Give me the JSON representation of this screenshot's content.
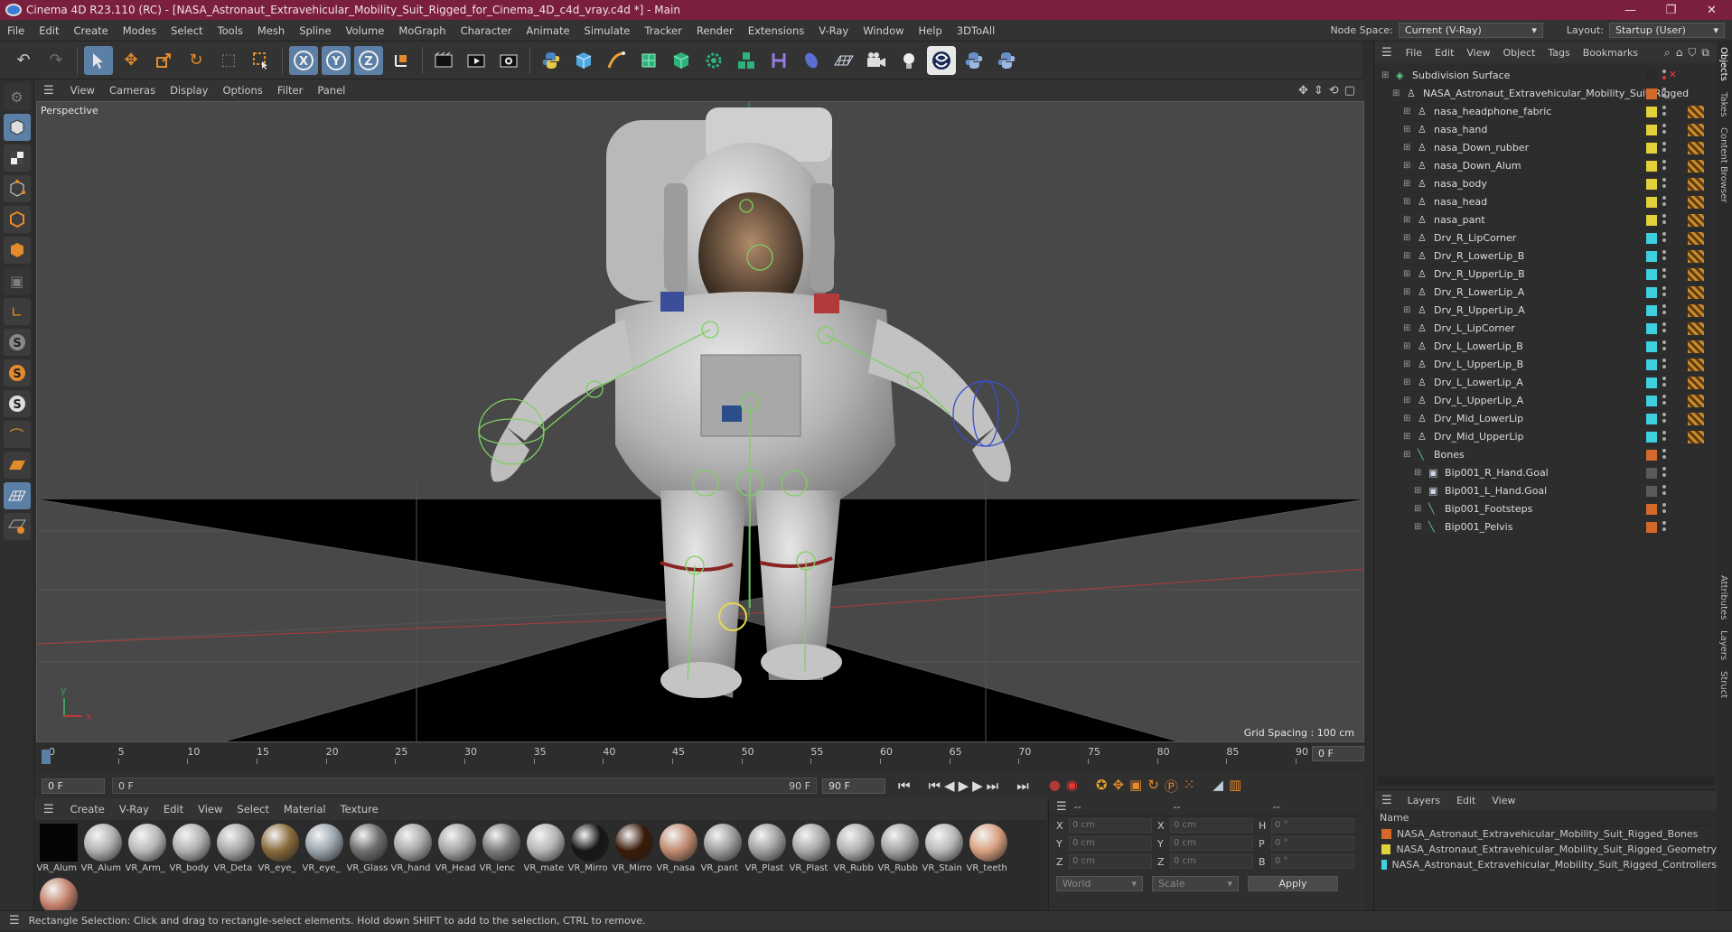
{
  "window": {
    "title": "Cinema 4D R23.110 (RC) - [NASA_Astronaut_Extravehicular_Mobility_Suit_Rigged_for_Cinema_4D_c4d_vray.c4d *] - Main",
    "controls": [
      "—",
      "❐",
      "✕"
    ]
  },
  "menu": [
    "File",
    "Edit",
    "Create",
    "Modes",
    "Select",
    "Tools",
    "Mesh",
    "Spline",
    "Volume",
    "MoGraph",
    "Character",
    "Animate",
    "Simulate",
    "Tracker",
    "Render",
    "Extensions",
    "V-Ray",
    "Window",
    "Help",
    "3DToAll"
  ],
  "node_space": {
    "label": "Node Space:",
    "value": "Current (V-Ray)"
  },
  "layout": {
    "label": "Layout:",
    "value": "Startup (User)"
  },
  "toolbar_icons": [
    "undo-icon",
    "redo-icon",
    "select-icon",
    "move-icon",
    "scale-icon",
    "rotate-icon",
    "recent-icon",
    "rect-select-icon",
    "x-axis-icon",
    "y-axis-icon",
    "z-axis-icon",
    "coord-system-icon",
    "render-view-icon",
    "render-picture-viewer-icon",
    "render-settings-icon",
    "python-icon",
    "cube-icon",
    "pen-icon",
    "subdivision-icon",
    "extrude-icon",
    "gear-generator-icon",
    "cloner-icon",
    "deformer-icon",
    "field-icon",
    "floor-icon",
    "camera-icon",
    "light-icon",
    "vray-icon",
    "python2-icon",
    "python3-icon"
  ],
  "viewport": {
    "menu": [
      "View",
      "Cameras",
      "Display",
      "Options",
      "Filter",
      "Panel"
    ],
    "name": "Perspective",
    "grid_spacing": "Grid Spacing : 100 cm",
    "axis_y": "y",
    "axis_x": "x"
  },
  "timeline": {
    "ticks": [
      "0",
      "5",
      "10",
      "15",
      "20",
      "25",
      "30",
      "35",
      "40",
      "45",
      "50",
      "55",
      "60",
      "65",
      "70",
      "75",
      "80",
      "85",
      "90"
    ],
    "current_frame": "0 F",
    "start_frame": "0 F",
    "slider_start": "0 F",
    "slider_end": "90 F",
    "end_frame": "90 F"
  },
  "material_menu": [
    "Create",
    "V-Ray",
    "Edit",
    "View",
    "Select",
    "Material",
    "Texture"
  ],
  "materials": [
    {
      "label": "VR_Alum",
      "color": "#050505"
    },
    {
      "label": "VR_Alum",
      "color": "#b0b0b0"
    },
    {
      "label": "VR_Arm_",
      "color": "#b8b8b8"
    },
    {
      "label": "VR_body",
      "color": "#b0b0b0"
    },
    {
      "label": "VR_Deta",
      "color": "#a8a8a8"
    },
    {
      "label": "VR_eye_",
      "color": "#8a6a3a"
    },
    {
      "label": "VR_eye_",
      "color": "#9aa4ad"
    },
    {
      "label": "VR_Glass",
      "color": "#6e6e6e"
    },
    {
      "label": "VR_hand",
      "color": "#a8a8a8"
    },
    {
      "label": "VR_Head",
      "color": "#a4a4a4"
    },
    {
      "label": "VR_lenc",
      "color": "#7a7a7a"
    },
    {
      "label": "VR_mate",
      "color": "#b4b4b4"
    },
    {
      "label": "VR_Mirro",
      "color": "#151515"
    },
    {
      "label": "VR_Mirro",
      "color": "#3a1a08"
    },
    {
      "label": "VR_nasa",
      "color": "#c08a70"
    },
    {
      "label": "VR_pant",
      "color": "#9c9c9c"
    },
    {
      "label": "VR_Plast",
      "color": "#a0a0a0"
    },
    {
      "label": "VR_Plast",
      "color": "#a8a8a8"
    },
    {
      "label": "VR_Rubb",
      "color": "#b0b0b0"
    },
    {
      "label": "VR_Rubb",
      "color": "#a4a4a4"
    },
    {
      "label": "VR_Stain",
      "color": "#b8b8b8"
    },
    {
      "label": "VR_teeth",
      "color": "#d9a080"
    },
    {
      "label": "",
      "color": "#c4806a"
    }
  ],
  "coords": {
    "header": [
      "--",
      "--",
      "--"
    ],
    "rows": [
      {
        "a": "X",
        "av": "0 cm",
        "b": "X",
        "bv": "0 cm",
        "c": "H",
        "cv": "0 °"
      },
      {
        "a": "Y",
        "av": "0 cm",
        "b": "Y",
        "bv": "0 cm",
        "c": "P",
        "cv": "0 °"
      },
      {
        "a": "Z",
        "av": "0 cm",
        "b": "Z",
        "bv": "0 cm",
        "c": "B",
        "cv": "0 °"
      }
    ],
    "space": "World",
    "mode": "Scale",
    "apply": "Apply"
  },
  "object_manager": {
    "menu": [
      "File",
      "Edit",
      "View",
      "Object",
      "Tags",
      "Bookmarks"
    ],
    "objects": [
      {
        "name": "Subdivision Surface",
        "indent": 0,
        "tag": "#2a2a2a",
        "tagicon": false
      },
      {
        "name": "NASA_Astronaut_Extravehicular_Mobility_Suit_Rigged",
        "indent": 1,
        "tag": "#d4692a",
        "tagicon": false
      },
      {
        "name": "nasa_headphone_fabric",
        "indent": 2,
        "tag": "#e2d13a",
        "tagicon": true
      },
      {
        "name": "nasa_hand",
        "indent": 2,
        "tag": "#e2d13a",
        "tagicon": true
      },
      {
        "name": "nasa_Down_rubber",
        "indent": 2,
        "tag": "#e2d13a",
        "tagicon": true
      },
      {
        "name": "nasa_Down_Alum",
        "indent": 2,
        "tag": "#e2d13a",
        "tagicon": true
      },
      {
        "name": "nasa_body",
        "indent": 2,
        "tag": "#e2d13a",
        "tagicon": true
      },
      {
        "name": "nasa_head",
        "indent": 2,
        "tag": "#e2d13a",
        "tagicon": true
      },
      {
        "name": "nasa_pant",
        "indent": 2,
        "tag": "#e2d13a",
        "tagicon": true
      },
      {
        "name": "Drv_R_LipCorner",
        "indent": 2,
        "tag": "#3fd0e0",
        "tagicon": true
      },
      {
        "name": "Drv_R_LowerLip_B",
        "indent": 2,
        "tag": "#3fd0e0",
        "tagicon": true
      },
      {
        "name": "Drv_R_UpperLip_B",
        "indent": 2,
        "tag": "#3fd0e0",
        "tagicon": true
      },
      {
        "name": "Drv_R_LowerLip_A",
        "indent": 2,
        "tag": "#3fd0e0",
        "tagicon": true
      },
      {
        "name": "Drv_R_UpperLip_A",
        "indent": 2,
        "tag": "#3fd0e0",
        "tagicon": true
      },
      {
        "name": "Drv_L_LipCorner",
        "indent": 2,
        "tag": "#3fd0e0",
        "tagicon": true
      },
      {
        "name": "Drv_L_LowerLip_B",
        "indent": 2,
        "tag": "#3fd0e0",
        "tagicon": true
      },
      {
        "name": "Drv_L_UpperLip_B",
        "indent": 2,
        "tag": "#3fd0e0",
        "tagicon": true
      },
      {
        "name": "Drv_L_LowerLip_A",
        "indent": 2,
        "tag": "#3fd0e0",
        "tagicon": true
      },
      {
        "name": "Drv_L_UpperLip_A",
        "indent": 2,
        "tag": "#3fd0e0",
        "tagicon": true
      },
      {
        "name": "Drv_Mid_LowerLip",
        "indent": 2,
        "tag": "#3fd0e0",
        "tagicon": true
      },
      {
        "name": "Drv_Mid_UpperLip",
        "indent": 2,
        "tag": "#3fd0e0",
        "tagicon": true
      },
      {
        "name": "Bones",
        "indent": 2,
        "tag": "#d4692a",
        "tagicon": false
      },
      {
        "name": "Bip001_R_Hand.Goal",
        "indent": 3,
        "tag": "#5a5a5a",
        "tagicon": false
      },
      {
        "name": "Bip001_L_Hand.Goal",
        "indent": 3,
        "tag": "#5a5a5a",
        "tagicon": false
      },
      {
        "name": "Bip001_Footsteps",
        "indent": 3,
        "tag": "#d4692a",
        "tagicon": false
      },
      {
        "name": "Bip001_Pelvis",
        "indent": 3,
        "tag": "#d4692a",
        "tagicon": false
      }
    ]
  },
  "layers": {
    "menu": [
      "Layers",
      "Edit",
      "View"
    ],
    "col": "Name",
    "items": [
      {
        "name": "NASA_Astronaut_Extravehicular_Mobility_Suit_Rigged_Bones",
        "color": "#d4692a"
      },
      {
        "name": "NASA_Astronaut_Extravehicular_Mobility_Suit_Rigged_Geometry",
        "color": "#e2d13a"
      },
      {
        "name": "NASA_Astronaut_Extravehicular_Mobility_Suit_Rigged_Controllers",
        "color": "#3fd0e0"
      }
    ]
  },
  "right_tabs": [
    "Objects",
    "Takes",
    "Content Browser",
    "Attributes",
    "Layers",
    "Struct"
  ],
  "status": "Rectangle Selection: Click and drag to rectangle-select elements. Hold down SHIFT to add to the selection, CTRL to remove."
}
